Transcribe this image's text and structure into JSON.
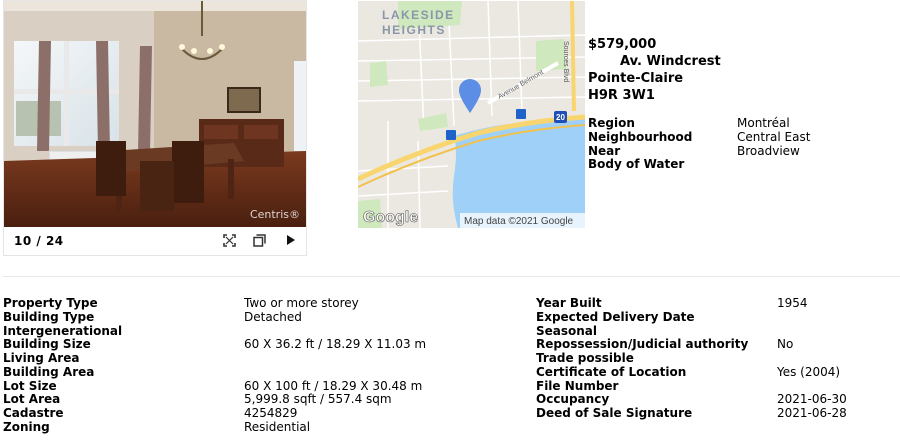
{
  "gallery": {
    "counter": "10 / 24",
    "watermark": "Centris®",
    "controls": [
      "fullscreen-icon",
      "gallery-icon",
      "play-icon"
    ]
  },
  "map": {
    "area_label_line1": "LAKESIDE",
    "area_label_line2": "HEIGHTS",
    "road_belmont": "Avenue Belmont",
    "road_sources": "Sources Blvd",
    "highway_number": "20",
    "logo": "Google",
    "attribution": "Map data ©2021 Google",
    "colors": {
      "land": "#ebe8e2",
      "water": "#9fd1f8",
      "park": "#cfe8bd",
      "highway": "#f9d56f",
      "pin": "#5c8ee6"
    }
  },
  "listing": {
    "price": "$579,000",
    "street": "Av. Windcrest",
    "city": "Pointe-Claire",
    "postal_code": "H9R 3W1"
  },
  "location": [
    {
      "label": "Region",
      "value": "Montréal"
    },
    {
      "label": "Neighbourhood",
      "value": "Central East"
    },
    {
      "label": "Near",
      "value": "Broadview"
    },
    {
      "label": "Body of Water",
      "value": ""
    }
  ],
  "details_left": [
    {
      "label": "Property Type",
      "value": "Two or more storey"
    },
    {
      "label": "Building Type",
      "value": "Detached"
    },
    {
      "label": "Intergenerational",
      "value": ""
    },
    {
      "label": "Building Size",
      "value": "60 X 36.2 ft / 18.29 X 11.03 m"
    },
    {
      "label": "Living Area",
      "value": ""
    },
    {
      "label": "Building Area",
      "value": ""
    },
    {
      "label": "Lot Size",
      "value": "60 X 100 ft / 18.29 X 30.48 m"
    },
    {
      "label": "Lot Area",
      "value": "5,999.8 sqft / 557.4 sqm"
    },
    {
      "label": "Cadastre",
      "value": "4254829"
    },
    {
      "label": "Zoning",
      "value": "Residential"
    }
  ],
  "details_right": [
    {
      "label": "Year Built",
      "value": "1954"
    },
    {
      "label": "Expected Delivery Date",
      "value": ""
    },
    {
      "label": "Seasonal",
      "value": ""
    },
    {
      "label": "Repossession/Judicial authority",
      "value": "No"
    },
    {
      "label": "Trade possible",
      "value": ""
    },
    {
      "label": "Certificate of Location",
      "value": "Yes (2004)"
    },
    {
      "label": "File Number",
      "value": ""
    },
    {
      "label": "Occupancy",
      "value": "2021-06-30"
    },
    {
      "label": "Deed of Sale Signature",
      "value": "2021-06-28"
    }
  ]
}
